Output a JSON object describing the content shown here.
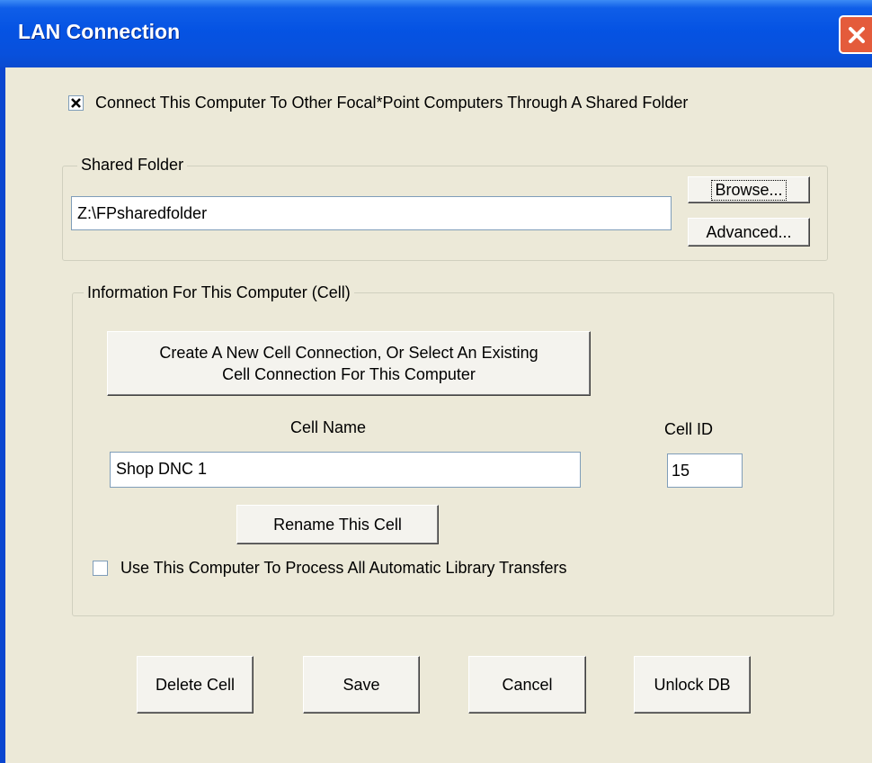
{
  "window": {
    "title": "LAN Connection"
  },
  "connect": {
    "checked": true,
    "label": "Connect This Computer To Other Focal*Point Computers Through A Shared Folder"
  },
  "shared_folder": {
    "legend": "Shared Folder",
    "path_value": "Z:\\FPsharedfolder",
    "browse_label": "Browse...",
    "advanced_label": "Advanced..."
  },
  "cell_info": {
    "legend": "Information For This Computer (Cell)",
    "create_line1": "Create A New Cell Connection, Or Select An Existing",
    "create_line2": "Cell Connection For This Computer",
    "cell_name_label": "Cell Name",
    "cell_name_value": "Shop DNC 1",
    "cell_id_label": "Cell ID",
    "cell_id_value": "15",
    "rename_label": "Rename This Cell",
    "auto_transfer": {
      "checked": false,
      "label": "Use This Computer To Process All Automatic Library Transfers"
    }
  },
  "buttons": {
    "delete": "Delete Cell",
    "save": "Save",
    "cancel": "Cancel",
    "unlock": "Unlock DB"
  }
}
